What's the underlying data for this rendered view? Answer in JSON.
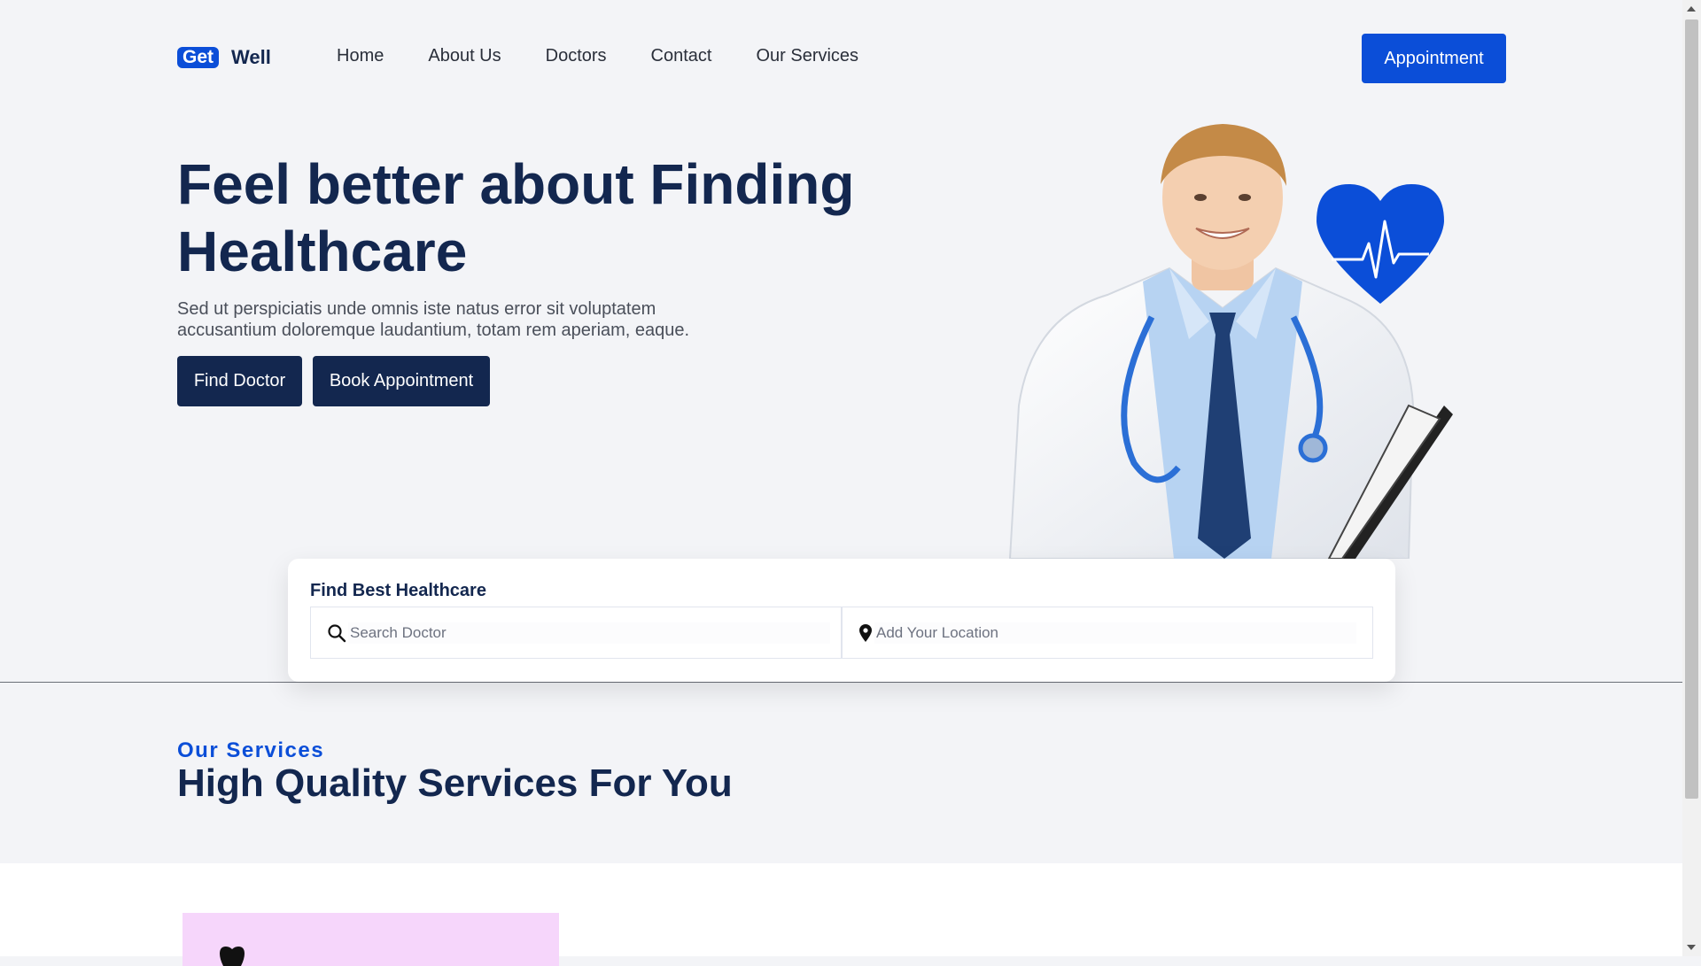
{
  "brand": {
    "badge": "Get",
    "name": "Well"
  },
  "nav": {
    "items": [
      "Home",
      "About Us",
      "Doctors",
      "Contact",
      "Our Services"
    ],
    "cta": "Appointment"
  },
  "hero": {
    "title": "Feel better about Finding Healthcare",
    "description": "Sed ut perspiciatis unde omnis iste natus error sit voluptatem accusantium doloremque laudantium, totam rem aperiam, eaque.",
    "buttons": {
      "find": "Find Doctor",
      "book": "Book Appointment"
    }
  },
  "search": {
    "title": "Find Best Healthcare",
    "doctor_placeholder": "Search Doctor",
    "location_placeholder": "Add Your Location"
  },
  "services": {
    "eyebrow": "Our Services",
    "title": "High Quality Services For You"
  },
  "icons": {
    "search": "search-icon",
    "location": "location-pin-icon",
    "heart": "heartbeat-icon",
    "service": "tooth-icon"
  },
  "colors": {
    "accent": "#0b4ed8",
    "navy": "#13274f",
    "background": "#f3f4f7",
    "service_card": "#f6d6fb"
  }
}
